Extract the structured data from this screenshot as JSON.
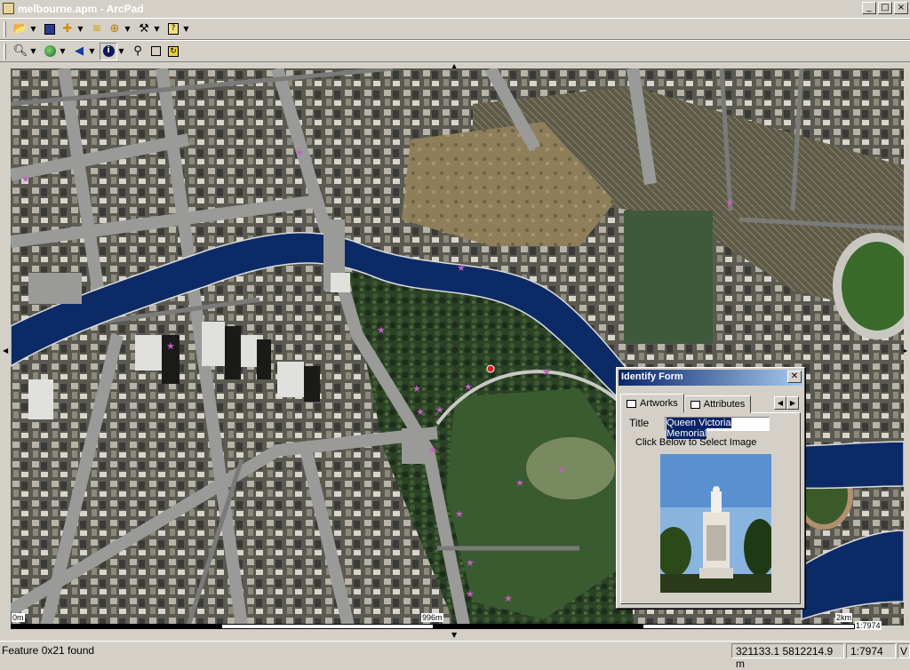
{
  "window": {
    "title": "melbourne.apm - ArcPad",
    "buttons": [
      "_",
      "□",
      "×"
    ]
  },
  "toolbar_main": {
    "icons": [
      "open-folder-icon",
      "save-icon",
      "add-layer-icon",
      "layers-icon",
      "gps-icon",
      "tools-icon",
      "help-icon"
    ]
  },
  "toolbar_nav": {
    "icons": [
      "zoom-in-icon",
      "globe-icon",
      "back-arrow-icon",
      "identify-icon",
      "find-icon",
      "select-box-icon",
      "refresh-icon"
    ]
  },
  "map": {
    "scale_start": "0m",
    "scale_mid": "996m",
    "scale_end": "2km",
    "scale_ratio": "1:7974"
  },
  "identify_form": {
    "title": "Identify Form",
    "tabs": [
      "Artworks",
      "Attributes"
    ],
    "field_label": "Title",
    "field_value": "Queen Victoria Memorial",
    "hint": "Click Below to Select Image"
  },
  "statusbar": {
    "message": "Feature 0x21 found",
    "coords": "321133.1 5812214.9 m",
    "scale": "1:7974",
    "mode": "V"
  },
  "colors": {
    "river": "#0c2a66",
    "map_bg": "#5b5c4f",
    "road": "#9a9a9a",
    "park": "#2e4a2a",
    "dialog_title": "#0a246a"
  }
}
